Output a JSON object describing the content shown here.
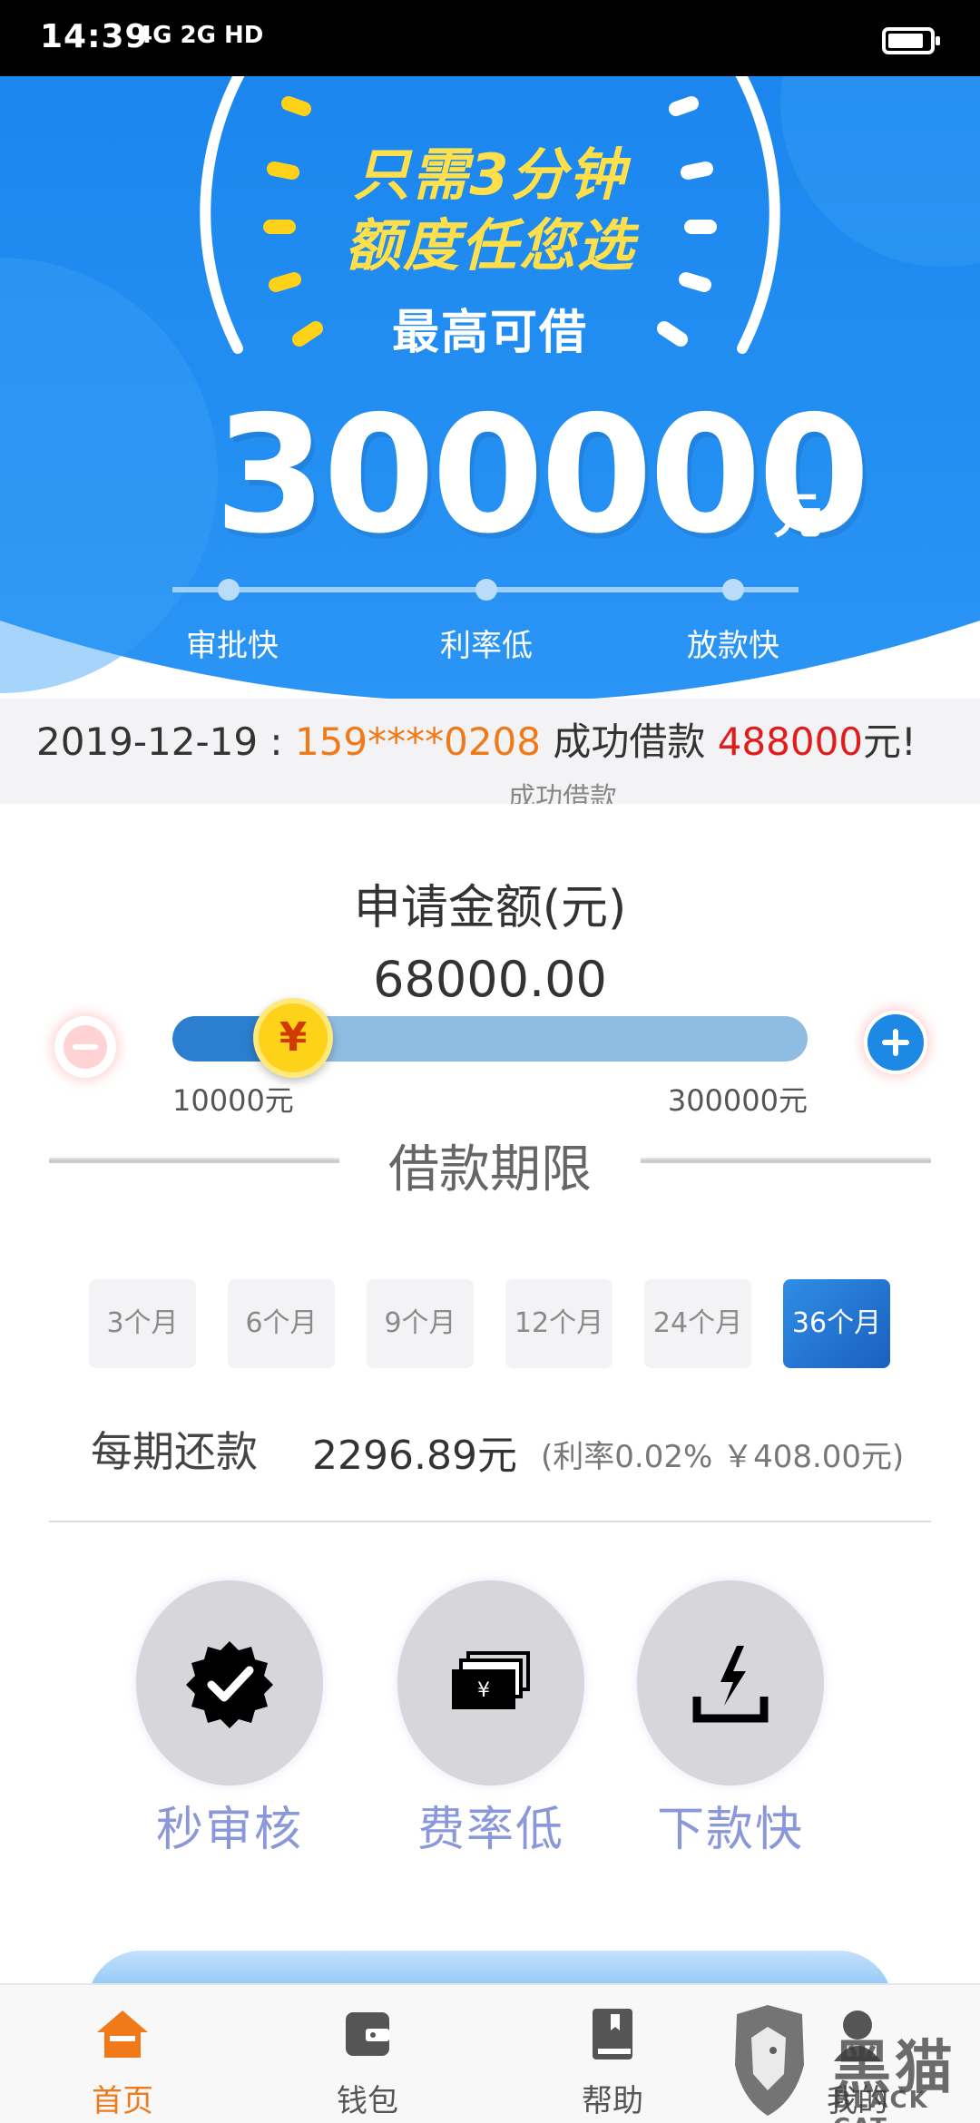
{
  "status_bar": {
    "time": "14:39",
    "signal": "4G  2G  HD"
  },
  "hero": {
    "slogan_line1": "只需3分钟",
    "slogan_line2": "额度任您选",
    "subtitle": "最高可借",
    "max_amount": "300000",
    "unit": "元",
    "features": [
      "审批快",
      "利率低",
      "放款快"
    ],
    "colors": {
      "background": "#1e8ef0",
      "slogan": "#ffe04a"
    }
  },
  "ticker": {
    "date": "2019-12-19 : ",
    "phone": "159****0208",
    "text": " 成功借款 ",
    "amount": "488000",
    "suffix": "元!",
    "next_partial": "成功借款"
  },
  "loan": {
    "title": "申请金额(元)",
    "value": "68000.00",
    "min_label": "10000元",
    "max_label": "300000元",
    "slider_fraction": 0.19,
    "currency_symbol": "¥"
  },
  "term": {
    "title": "借款期限",
    "options": [
      "3个月",
      "6个月",
      "9个月",
      "12个月",
      "24个月",
      "36个月"
    ],
    "selected": "36个月"
  },
  "payment": {
    "label": "每期还款",
    "value": "2296.89元",
    "note": "(利率0.02% ￥408.00元)"
  },
  "features": [
    {
      "icon": "verified-badge-icon",
      "label": "秒审核"
    },
    {
      "icon": "money-stack-icon",
      "label": "费率低"
    },
    {
      "icon": "download-tray-icon",
      "label": "下款快"
    }
  ],
  "nav": {
    "items": [
      {
        "icon": "home-icon",
        "label": "首页",
        "active": true
      },
      {
        "icon": "wallet-icon",
        "label": "钱包",
        "active": false
      },
      {
        "icon": "book-icon",
        "label": "帮助",
        "active": false
      },
      {
        "icon": "user-icon",
        "label": "我的",
        "active": false
      }
    ],
    "accent": "#f07a1a"
  },
  "watermark": {
    "text": "黑猫",
    "sub": "BLACK CAT"
  }
}
